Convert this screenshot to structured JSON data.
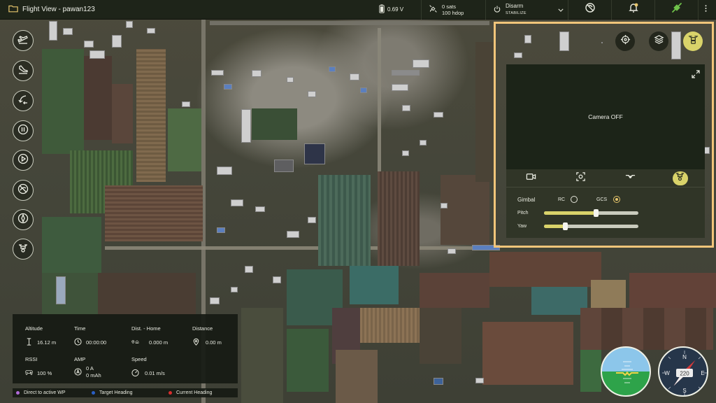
{
  "app": {
    "title": "Flight View - pawan123"
  },
  "status": {
    "battery_voltage": "0.69 V",
    "sats": "0 sats",
    "hdop": "100 hdop",
    "arm_state": "Disarm",
    "flight_mode": "STABILIZE"
  },
  "topbar_icons": [
    "chevron-down-icon",
    "no-gps-icon",
    "bell-icon",
    "plug-icon",
    "more-icon"
  ],
  "left_tools": [
    "takeoff-icon",
    "land-icon",
    "return-home-icon",
    "pause-icon",
    "play-icon",
    "hide-icon",
    "compass-arrow-icon",
    "drone-gimbal-icon"
  ],
  "camera": {
    "state_text": "Camera OFF",
    "top_buttons": [
      "target-icon",
      "layers-icon",
      "drone-camera-icon"
    ],
    "tabs": [
      "video-camera-icon",
      "capture-icon",
      "drone-icon",
      "gimbal-icon"
    ],
    "active_tab": 3,
    "gimbal_label": "Gimbal",
    "rc_label": "RC",
    "gcs_label": "GCS",
    "gimbal_source": "GCS",
    "pitch_label": "Pitch",
    "yaw_label": "Yaw",
    "pitch_level": 0.55,
    "yaw_level": 0.22
  },
  "telemetry": {
    "altitude_label": "Altitude",
    "altitude_value": "16.12 m",
    "time_label": "Time",
    "time_value": "00:00:00",
    "dist_home_label": "Dist. - Home",
    "dist_home_value": "0.000 m",
    "distance_label": "Distance",
    "distance_value": "0.00 m",
    "rssi_label": "RSSI",
    "rssi_value": "100 %",
    "amp_label": "AMP",
    "amp_value": "0 A",
    "mah_value": "0 mAh",
    "speed_label": "Speed",
    "speed_value": "0.01 m/s"
  },
  "legend": [
    {
      "label": "Direct to active WP",
      "color": "#b06ad8"
    },
    {
      "label": "Target Heading",
      "color": "#2a5fc4"
    },
    {
      "label": "Current Heading",
      "color": "#d92d2d"
    }
  ],
  "compass": {
    "heading": "220",
    "north": "N",
    "south": "S",
    "east": "E",
    "west": "W"
  }
}
